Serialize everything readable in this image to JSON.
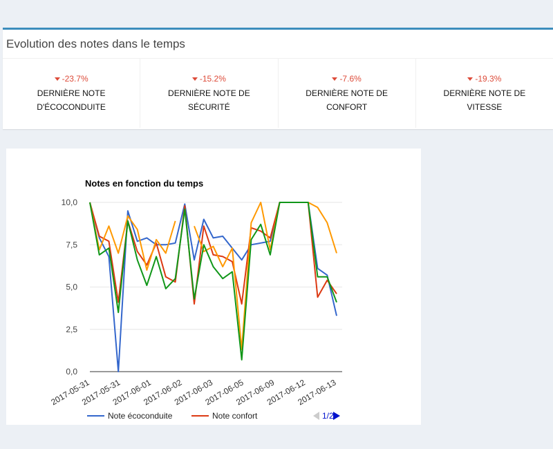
{
  "header": {
    "title": "Evolution des notes dans le temps"
  },
  "kpis": [
    {
      "pct": "-23.7%",
      "label": "Dernière note d'écoconduite"
    },
    {
      "pct": "-15.2%",
      "label": "Dernière note de sécurité"
    },
    {
      "pct": "-7.6%",
      "label": "Dernière note de confort"
    },
    {
      "pct": "-19.3%",
      "label": "Dernière note de vitesse"
    }
  ],
  "legend": {
    "page": "1/2"
  },
  "colors": {
    "accent": "#3c8dbc",
    "negative": "#dd4b39",
    "series": [
      "#3366cc",
      "#dc3912",
      "#ff9900",
      "#109618"
    ]
  },
  "chart_data": {
    "type": "line",
    "title": "Notes en fonction du temps",
    "xlabel": "",
    "ylabel": "",
    "ylim": [
      0,
      10
    ],
    "yticks": [
      "0,0",
      "2,5",
      "5,0",
      "7,5",
      "10,0"
    ],
    "x_tick_labels": [
      "2017-05-31",
      "2017-05-31",
      "2017-06-01",
      "2017-06-02",
      "2017-06-03",
      "2017-06-05",
      "2017-06-09",
      "2017-06-12",
      "2017-06-13"
    ],
    "legend_position": "bottom",
    "grid": true,
    "series": [
      {
        "name": "Note écoconduite",
        "values": [
          10.0,
          7.9,
          6.8,
          0.0,
          9.5,
          7.7,
          7.9,
          7.5,
          7.5,
          7.6,
          9.9,
          6.6,
          9.0,
          7.9,
          8.0,
          7.3,
          6.6,
          7.5,
          7.6,
          7.7,
          10.0,
          10.0,
          10.0,
          10.0,
          6.1,
          5.7,
          3.3
        ]
      },
      {
        "name": "Note confort",
        "values": [
          10.0,
          8.0,
          7.7,
          4.1,
          8.9,
          7.1,
          6.3,
          7.6,
          5.6,
          5.3,
          9.8,
          4.0,
          8.6,
          6.9,
          6.8,
          6.5,
          4.0,
          8.5,
          8.3,
          7.9,
          10.0,
          10.0,
          10.0,
          10.0,
          4.4,
          5.4,
          4.6
        ]
      },
      {
        "name": "",
        "values": [
          10.0,
          7.2,
          8.6,
          7.0,
          9.2,
          8.4,
          6.0,
          7.8,
          7.0,
          8.9,
          null,
          8.6,
          7.1,
          7.4,
          6.2,
          7.3,
          1.3,
          8.8,
          10.0,
          7.2,
          10.0,
          10.0,
          10.0,
          10.0,
          9.7,
          8.8,
          7.0
        ]
      },
      {
        "name": "",
        "values": [
          10.0,
          6.9,
          7.3,
          3.5,
          8.9,
          6.6,
          5.1,
          6.8,
          4.9,
          5.5,
          9.6,
          4.3,
          7.5,
          6.2,
          5.5,
          5.9,
          0.7,
          7.8,
          8.7,
          6.9,
          10.0,
          10.0,
          10.0,
          10.0,
          5.6,
          5.6,
          4.1
        ]
      }
    ]
  }
}
